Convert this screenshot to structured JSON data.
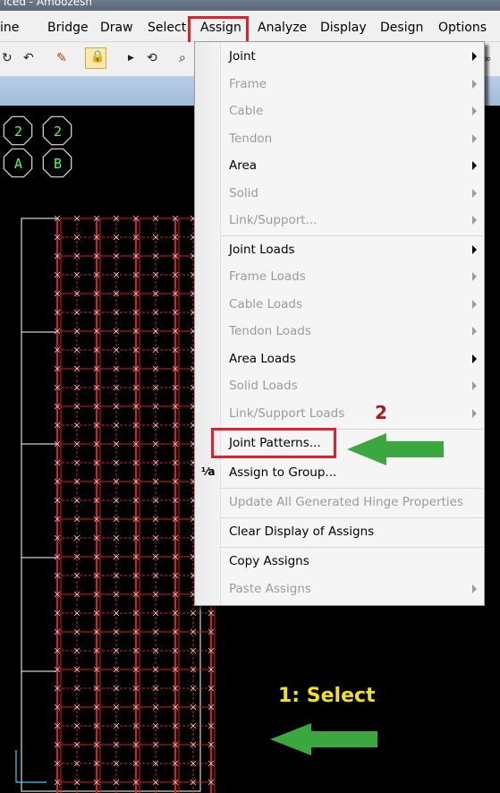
{
  "window": {
    "title_fragment": "iced - Amoozesh"
  },
  "menubar": {
    "items": [
      {
        "label": "ine",
        "accel": ""
      },
      {
        "label": "Bridge",
        "accel": "B"
      },
      {
        "label": "Draw",
        "accel": "r"
      },
      {
        "label": "Select",
        "accel": "S"
      },
      {
        "label": "Assign",
        "accel": "A"
      },
      {
        "label": "Analyze",
        "accel": "n"
      },
      {
        "label": "Display",
        "accel": "p"
      },
      {
        "label": "Design",
        "accel": "g"
      },
      {
        "label": "Options",
        "accel": "O"
      }
    ]
  },
  "assign_menu": {
    "items": [
      {
        "label": "Joint",
        "enabled": true,
        "submenu": true
      },
      {
        "label": "Frame",
        "enabled": false,
        "submenu": true
      },
      {
        "label": "Cable",
        "enabled": false,
        "submenu": true
      },
      {
        "label": "Tendon",
        "enabled": false,
        "submenu": true
      },
      {
        "label": "Area",
        "enabled": true,
        "submenu": true
      },
      {
        "label": "Solid",
        "enabled": false,
        "submenu": true
      },
      {
        "label": "Link/Support...",
        "enabled": false,
        "submenu": true
      },
      {
        "label": "Joint Loads",
        "enabled": true,
        "submenu": true
      },
      {
        "label": "Frame Loads",
        "enabled": false,
        "submenu": true
      },
      {
        "label": "Cable Loads",
        "enabled": false,
        "submenu": true
      },
      {
        "label": "Tendon Loads",
        "enabled": false,
        "submenu": true
      },
      {
        "label": "Area Loads",
        "enabled": true,
        "submenu": true
      },
      {
        "label": "Solid Loads",
        "enabled": false,
        "submenu": true
      },
      {
        "label": "Link/Support Loads",
        "enabled": false,
        "submenu": true
      },
      {
        "label": "Joint Patterns...",
        "enabled": true,
        "submenu": false
      },
      {
        "label": "Assign to Group...",
        "enabled": true,
        "submenu": false
      },
      {
        "label": "Update All Generated Hinge Properties",
        "enabled": false,
        "submenu": false
      },
      {
        "label": "Clear Display of Assigns",
        "enabled": true,
        "submenu": false
      },
      {
        "label": "Copy Assigns",
        "enabled": true,
        "submenu": false
      },
      {
        "label": "Paste Assigns",
        "enabled": false,
        "submenu": true
      }
    ]
  },
  "annotations": {
    "step2": "2",
    "step1": "1: Select",
    "arrow_color": "#3aa83f",
    "highlight_color": "#e0202a"
  },
  "grid_bubbles": [
    {
      "label": "2"
    },
    {
      "label": "2"
    },
    {
      "label": "A"
    },
    {
      "label": "B"
    }
  ],
  "colors": {
    "canvas": "#000000",
    "mesh": "#d42020",
    "grid_lines": "#ffffff",
    "bubble_text": "#4cff4c"
  }
}
